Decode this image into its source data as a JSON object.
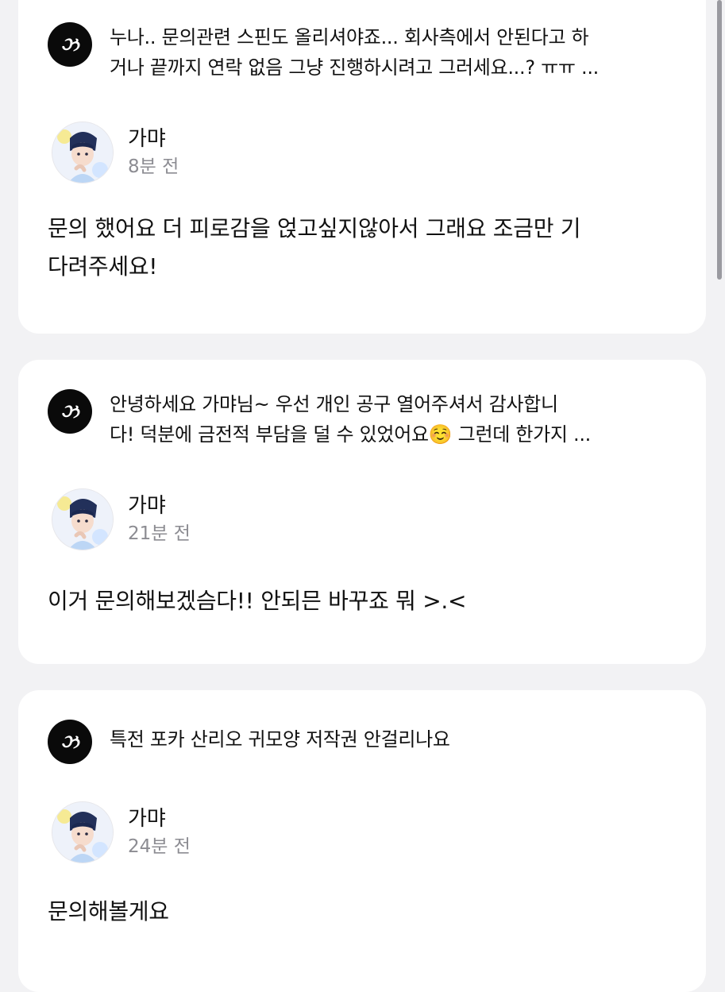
{
  "cards": [
    {
      "question": "누나.. 문의관련 스핀도 올리셔야죠... 회사측에서 안된다고 하\n거나 끝까지 연락 없음 그냥 진행하시려고 그러세요...? ㅠㅠ ...",
      "author": "가먀",
      "time": "8분 전",
      "answer": "문의 했어요 더 피로감을 얹고싶지않아서 그래요 조금만 기\n다려주세요!"
    },
    {
      "question": "안녕하세요 가먀님~ 우선 개인 공구 열어주셔서 감사합니\n다! 덕분에 금전적 부담을 덜 수 있었어요☺️ 그런데 한가지 ...",
      "author": "가먀",
      "time": "21분 전",
      "answer": "이거 문의해보겠슴다!! 안되믄 바꾸죠 뭐 >.<"
    },
    {
      "question": "특전 포카 산리오 귀모양 저작권 안걸리나요",
      "author": "가먀",
      "time": "24분 전",
      "answer": "문의해볼게요"
    }
  ],
  "icons": {
    "question_icon": "question-mark-logo-icon",
    "avatar": "illustrated-profile-avatar"
  },
  "colors": {
    "background": "#f2f2f4",
    "card": "#ffffff",
    "icon_bg": "#0a0a0a",
    "time_text": "#8c8c92"
  }
}
